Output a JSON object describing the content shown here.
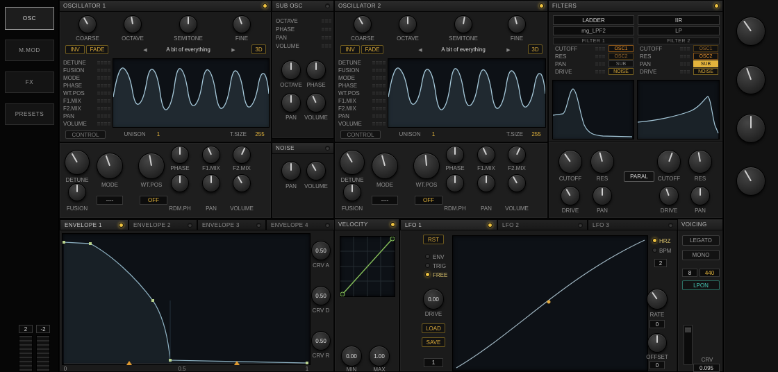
{
  "colors": {
    "accent_yellow": "#eec23f",
    "accent_orange": "#e8932e",
    "accent_teal": "#45c4b2",
    "wave_blue": "#a6c9da"
  },
  "icons": {
    "prev": "◀",
    "next": "▶"
  },
  "sidebar": {
    "items": [
      "OSC",
      "M.MOD",
      "FX",
      "PRESETS"
    ]
  },
  "osc1": {
    "title": "OSCILLATOR 1",
    "tune_knobs": [
      "COARSE",
      "OCTAVE",
      "SEMITONE",
      "FINE"
    ],
    "inv_label": "INV",
    "fade_label": "FADE",
    "wavetable_name": "A bit of everything",
    "threed_label": "3D",
    "params": [
      "DETUNE",
      "FUSION",
      "MODE",
      "PHASE",
      "WT.POS",
      "F1.MIX",
      "F2.MIX",
      "PAN",
      "VOLUME"
    ],
    "control_label": "CONTROL",
    "unison_label": "UNISON",
    "unison_value": "1",
    "tsize_label": "T.SIZE",
    "tsize_value": "255"
  },
  "osc2": {
    "title": "OSCILLATOR 2",
    "tune_knobs": [
      "COARSE",
      "OCTAVE",
      "SEMITONE",
      "FINE"
    ],
    "inv_label": "INV",
    "fade_label": "FADE",
    "wavetable_name": "A bit of everything",
    "threed_label": "3D",
    "params": [
      "DETUNE",
      "FUSION",
      "MODE",
      "PHASE",
      "WT.POS",
      "F1.MIX",
      "F2.MIX",
      "PAN",
      "VOLUME"
    ],
    "control_label": "CONTROL",
    "unison_label": "UNISON",
    "unison_value": "1",
    "tsize_label": "T.SIZE",
    "tsize_value": "255"
  },
  "sub_osc": {
    "title": "SUB OSC",
    "params": [
      "OCTAVE",
      "PHASE",
      "PAN",
      "VOLUME"
    ],
    "knobs": [
      "OCTAVE",
      "PHASE",
      "PAN",
      "VOLUME"
    ]
  },
  "noise": {
    "title": "NOISE",
    "knobs": [
      "PAN",
      "VOLUME"
    ]
  },
  "osc_knob_row": {
    "top": [
      "DETUNE",
      "MODE",
      "WT.POS"
    ],
    "right_top": [
      "PHASE",
      "F1.MIX",
      "F2.MIX"
    ],
    "right_bottom": [
      "RDM.PH",
      "PAN",
      "VOLUME"
    ],
    "fusion": "FUSION",
    "mode_value": "----",
    "wtpos_value": "OFF"
  },
  "filters": {
    "title": "FILTERS",
    "filter1": {
      "type": "LADDER",
      "model": "mg_LPF2",
      "label": "FILTER 1",
      "params": [
        "CUTOFF",
        "RES",
        "PAN",
        "DRIVE"
      ],
      "routes": [
        "OSC1",
        "OSC2",
        "SUB",
        "NOISE"
      ]
    },
    "filter2": {
      "type": "IIR",
      "model": "LP",
      "label": "FILTER 2",
      "params": [
        "CUTOFF",
        "RES",
        "PAN",
        "DRIVE"
      ],
      "routes": [
        "OSC1",
        "OSC2",
        "SUB",
        "NOISE"
      ]
    },
    "paral_label": "PARAL",
    "knobs_row1": [
      "CUTOFF",
      "RES"
    ],
    "knobs_row2": [
      "DRIVE",
      "PAN"
    ]
  },
  "envelopes": {
    "tabs": [
      "ENVELOPE 1",
      "ENVELOPE 2",
      "ENVELOPE 3",
      "ENVELOPE 4"
    ],
    "crv_a_label": "CRV A",
    "crv_a_value": "0.50",
    "crv_d_label": "CRV D",
    "crv_d_value": "0.50",
    "crv_r_label": "CRV R",
    "crv_r_value": "0.50",
    "axis": [
      "0",
      "0.5",
      "1"
    ]
  },
  "mini_sliders": [
    "2",
    "-2"
  ],
  "velocity": {
    "title": "VELOCITY",
    "min_label": "MIN",
    "min_value": "0.00",
    "max_label": "MAX",
    "max_value": "1.00"
  },
  "lfo": {
    "tabs": [
      "LFO 1",
      "LFO 2",
      "LFO 3"
    ],
    "rst_label": "RST",
    "modes": [
      "ENV",
      "TRIG",
      "FREE"
    ],
    "drive_value": "0.00",
    "drive_label": "DRIVE",
    "load_label": "LOAD",
    "save_label": "SAVE",
    "step_value": "1",
    "hrz_label": "HRZ",
    "bpm_label": "BPM",
    "sync_value": "2",
    "rate_label": "RATE",
    "rate_value": "0",
    "offset_label": "OFFSET",
    "offset_value": "0"
  },
  "voicing": {
    "title": "VOICING",
    "legato_label": "LEGATO",
    "mono_label": "MONO",
    "voices_value": "8",
    "tune_value": "440",
    "lpon_label": "LPON",
    "crv_label": "CRV",
    "crv_value": "0.095"
  }
}
